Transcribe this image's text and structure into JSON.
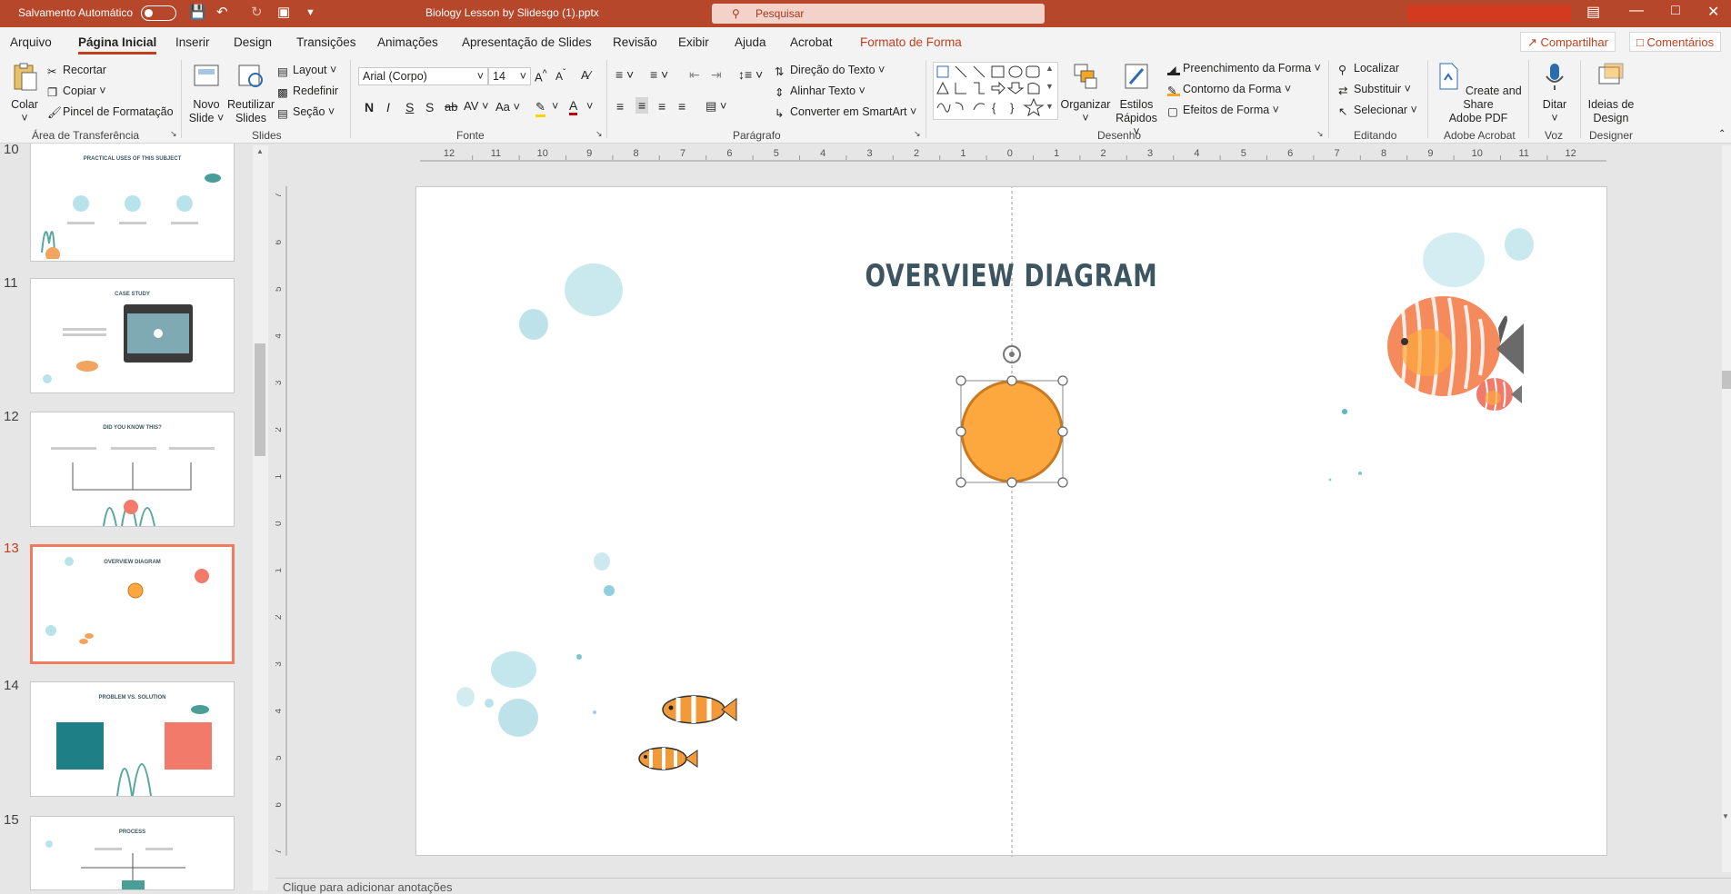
{
  "titlebar": {
    "autosave_label": "Salvamento Automático",
    "filename": "Biology Lesson by Slidesgo (1).pptx",
    "search_placeholder": "Pesquisar"
  },
  "menu": {
    "tabs": [
      "Arquivo",
      "Página Inicial",
      "Inserir",
      "Design",
      "Transições",
      "Animações",
      "Apresentação de Slides",
      "Revisão",
      "Exibir",
      "Ajuda",
      "Acrobat",
      "Formato de Forma"
    ],
    "share": "Compartilhar",
    "comments": "Comentários"
  },
  "ribbon": {
    "clipboard": {
      "paste": "Colar",
      "cut": "Recortar",
      "copy": "Copiar",
      "format_painter": "Pincel de Formatação",
      "label": "Área de Transferência"
    },
    "slides": {
      "new_line1": "Novo",
      "new_line2": "Slide",
      "reuse_line1": "Reutilizar",
      "reuse_line2": "Slides",
      "layout": "Layout",
      "reset": "Redefinir",
      "section": "Seção",
      "label": "Slides"
    },
    "font": {
      "name": "Arial (Corpo)",
      "size": "14",
      "label": "Fonte"
    },
    "paragraph": {
      "text_direction": "Direção do Texto",
      "align_text": "Alinhar Texto",
      "smartart": "Converter em SmartArt",
      "label": "Parágrafo"
    },
    "drawing": {
      "arrange": "Organizar",
      "quick_styles_line1": "Estilos",
      "quick_styles_line2": "Rápidos",
      "shape_fill": "Preenchimento da Forma",
      "shape_outline": "Contorno da Forma",
      "shape_effects": "Efeitos de Forma",
      "label": "Desenho"
    },
    "editing": {
      "find": "Localizar",
      "replace": "Substituir",
      "select": "Selecionar",
      "label": "Editando"
    },
    "acrobat": {
      "line1": "Create and Share",
      "line2": "Adobe PDF",
      "label": "Adobe Acrobat"
    },
    "voice": {
      "dictate": "Ditar",
      "label": "Voz"
    },
    "designer": {
      "line1": "Ideias de",
      "line2": "Design",
      "label": "Designer"
    }
  },
  "thumbnails": [
    {
      "num": "10",
      "title": "PRACTICAL USES OF THIS SUBJECT"
    },
    {
      "num": "11",
      "title": "CASE STUDY"
    },
    {
      "num": "12",
      "title": "DID YOU KNOW THIS?"
    },
    {
      "num": "13",
      "title": "OVERVIEW DIAGRAM"
    },
    {
      "num": "14",
      "title": "PROBLEM VS. SOLUTION"
    },
    {
      "num": "15",
      "title": "PROCESS"
    }
  ],
  "ruler": {
    "top": [
      "12",
      "11",
      "10",
      "9",
      "8",
      "7",
      "6",
      "5",
      "4",
      "3",
      "2",
      "1",
      "0",
      "1",
      "2",
      "3",
      "4",
      "5",
      "6",
      "7",
      "8",
      "9",
      "10",
      "11",
      "12"
    ],
    "left": [
      "7",
      "6",
      "5",
      "4",
      "3",
      "2",
      "1",
      "0",
      "1",
      "2",
      "3",
      "4",
      "5",
      "6",
      "7"
    ]
  },
  "slide": {
    "title": "OVERVIEW DIAGRAM"
  },
  "notes_placeholder": "Clique para adicionar anotações",
  "colors": {
    "accent": "#b7472a",
    "circle_fill": "#fda83e",
    "circle_stroke": "#c97a21",
    "title_color": "#3d5560"
  }
}
